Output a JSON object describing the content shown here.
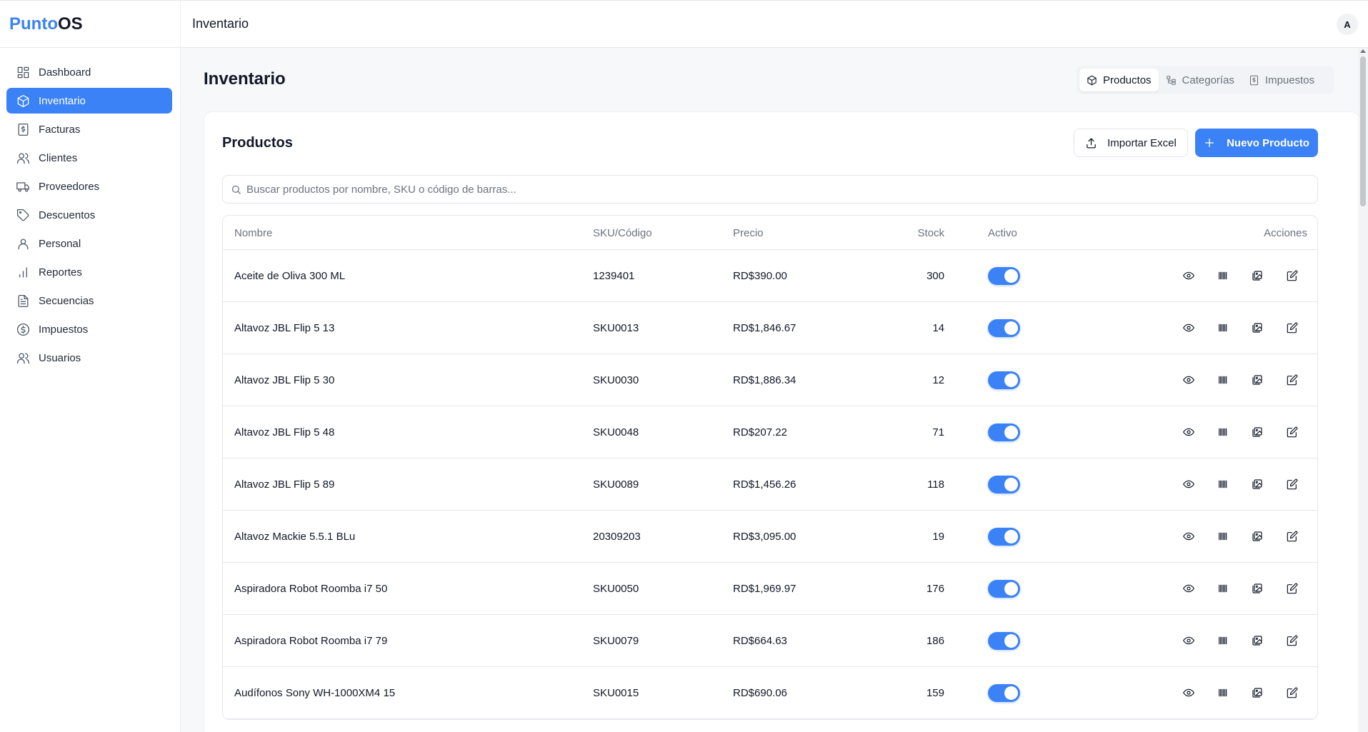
{
  "app": {
    "logo_part1": "Punto",
    "logo_part2": "OS",
    "topbar_title": "Inventario",
    "avatar": "A"
  },
  "sidebar": {
    "items": [
      {
        "label": "Dashboard",
        "icon": "dashboard-icon"
      },
      {
        "label": "Inventario",
        "icon": "box-icon",
        "active": true
      },
      {
        "label": "Facturas",
        "icon": "invoice-icon"
      },
      {
        "label": "Clientes",
        "icon": "users-icon"
      },
      {
        "label": "Proveedores",
        "icon": "truck-icon"
      },
      {
        "label": "Descuentos",
        "icon": "tag-icon"
      },
      {
        "label": "Personal",
        "icon": "user-icon"
      },
      {
        "label": "Reportes",
        "icon": "bar-chart-icon"
      },
      {
        "label": "Secuencias",
        "icon": "document-icon"
      },
      {
        "label": "Impuestos",
        "icon": "dollar-circle-icon"
      },
      {
        "label": "Usuarios",
        "icon": "users-icon"
      }
    ]
  },
  "page": {
    "title": "Inventario",
    "tabs": [
      {
        "label": "Productos",
        "icon": "box-icon",
        "active": true
      },
      {
        "label": "Categorías",
        "icon": "category-icon"
      },
      {
        "label": "Impuestos",
        "icon": "tax-icon"
      }
    ]
  },
  "products": {
    "title": "Productos",
    "import_label": "Importar Excel",
    "new_label": "Nuevo Producto",
    "search_placeholder": "Buscar productos por nombre, SKU o código de barras...",
    "columns": {
      "name": "Nombre",
      "sku": "SKU/Código",
      "price": "Precio",
      "stock": "Stock",
      "active": "Activo",
      "actions": "Acciones"
    },
    "rows": [
      {
        "name": "Aceite de Oliva 300 ML",
        "sku": "1239401",
        "price": "RD$390.00",
        "stock": "300",
        "active": true
      },
      {
        "name": "Altavoz JBL Flip 5 13",
        "sku": "SKU0013",
        "price": "RD$1,846.67",
        "stock": "14",
        "active": true
      },
      {
        "name": "Altavoz JBL Flip 5 30",
        "sku": "SKU0030",
        "price": "RD$1,886.34",
        "stock": "12",
        "active": true
      },
      {
        "name": "Altavoz JBL Flip 5 48",
        "sku": "SKU0048",
        "price": "RD$207.22",
        "stock": "71",
        "active": true
      },
      {
        "name": "Altavoz JBL Flip 5 89",
        "sku": "SKU0089",
        "price": "RD$1,456.26",
        "stock": "118",
        "active": true
      },
      {
        "name": "Altavoz Mackie 5.5.1 BLu",
        "sku": "20309203",
        "price": "RD$3,095.00",
        "stock": "19",
        "active": true
      },
      {
        "name": "Aspiradora Robot Roomba i7 50",
        "sku": "SKU0050",
        "price": "RD$1,969.97",
        "stock": "176",
        "active": true
      },
      {
        "name": "Aspiradora Robot Roomba i7 79",
        "sku": "SKU0079",
        "price": "RD$664.63",
        "stock": "186",
        "active": true
      },
      {
        "name": "Audífonos Sony WH-1000XM4 15",
        "sku": "SKU0015",
        "price": "RD$690.06",
        "stock": "159",
        "active": true
      }
    ]
  },
  "colors": {
    "accent": "#3b82f6",
    "text": "#111827",
    "muted": "#6b7280"
  }
}
